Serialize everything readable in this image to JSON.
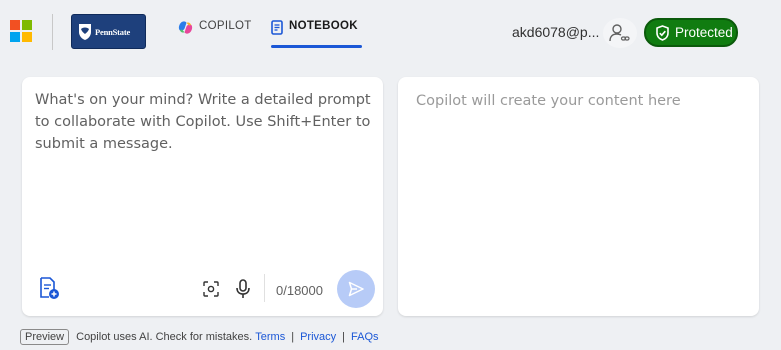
{
  "header": {
    "org_name": "PennState",
    "tabs": [
      {
        "label": "COPILOT",
        "active": false
      },
      {
        "label": "NOTEBOOK",
        "active": true
      }
    ],
    "account_name": "akd6078@p...",
    "protected_label": "Protected"
  },
  "input_panel": {
    "placeholder": "What's on your mind? Write a detailed prompt to collaborate with Copilot. Use Shift+Enter to submit a message.",
    "value": "",
    "char_count": "0/18000"
  },
  "output_panel": {
    "placeholder": "Copilot will create your content here"
  },
  "footer": {
    "preview_label": "Preview",
    "disclaimer": "Copilot uses AI. Check for mistakes.",
    "links": [
      "Terms",
      "Privacy",
      "FAQs"
    ]
  },
  "colors": {
    "accent": "#1b57d6",
    "protected_green": "#107c10",
    "send_button_disabled": "#b7cbf7",
    "org_navy": "#1e407c"
  },
  "icons": [
    "microsoft-logo",
    "pennstate-shield-icon",
    "copilot-icon",
    "notebook-icon",
    "person-link-icon",
    "shield-check-icon",
    "notebook-add-icon",
    "screenshot-icon",
    "microphone-icon",
    "send-icon"
  ]
}
